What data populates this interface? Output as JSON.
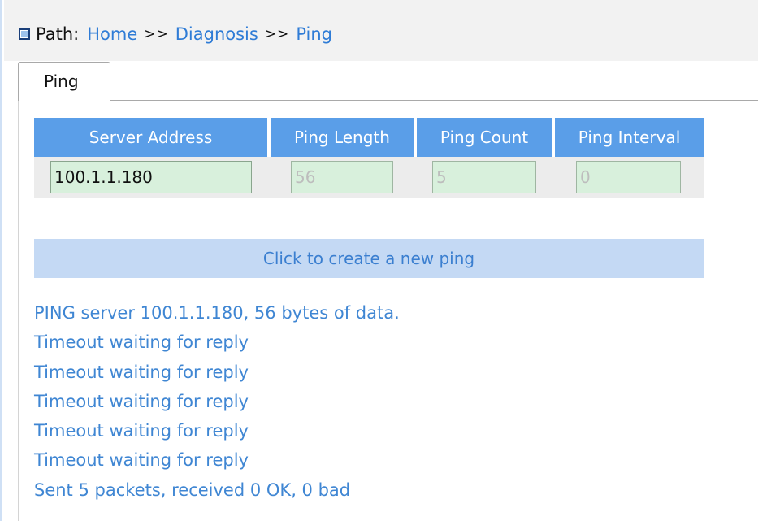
{
  "breadcrumb": {
    "label": "Path:",
    "items": [
      "Home",
      "Diagnosis",
      "Ping"
    ],
    "separator": ">>"
  },
  "tabs": [
    {
      "label": "Ping",
      "active": true
    }
  ],
  "form": {
    "columns": [
      "Server Address",
      "Ping Length",
      "Ping Count",
      "Ping Interval"
    ],
    "values": {
      "server_address": "100.1.1.180",
      "ping_length": "56",
      "ping_count": "5",
      "ping_interval": "0"
    }
  },
  "create_button": "Click to create a new ping",
  "output": [
    "PING server 100.1.1.180, 56 bytes of data.",
    "Timeout waiting for reply",
    "Timeout waiting for reply",
    "Timeout waiting for reply",
    "Timeout waiting for reply",
    "Timeout waiting for reply",
    "Sent 5 packets, received 0 OK, 0 bad"
  ],
  "colors": {
    "header_bg": "#5a9ee8",
    "link": "#2f7cd6",
    "input_bg": "#d8f0dc",
    "button_bg": "#c4d9f4",
    "output_text": "#3f86d3"
  }
}
